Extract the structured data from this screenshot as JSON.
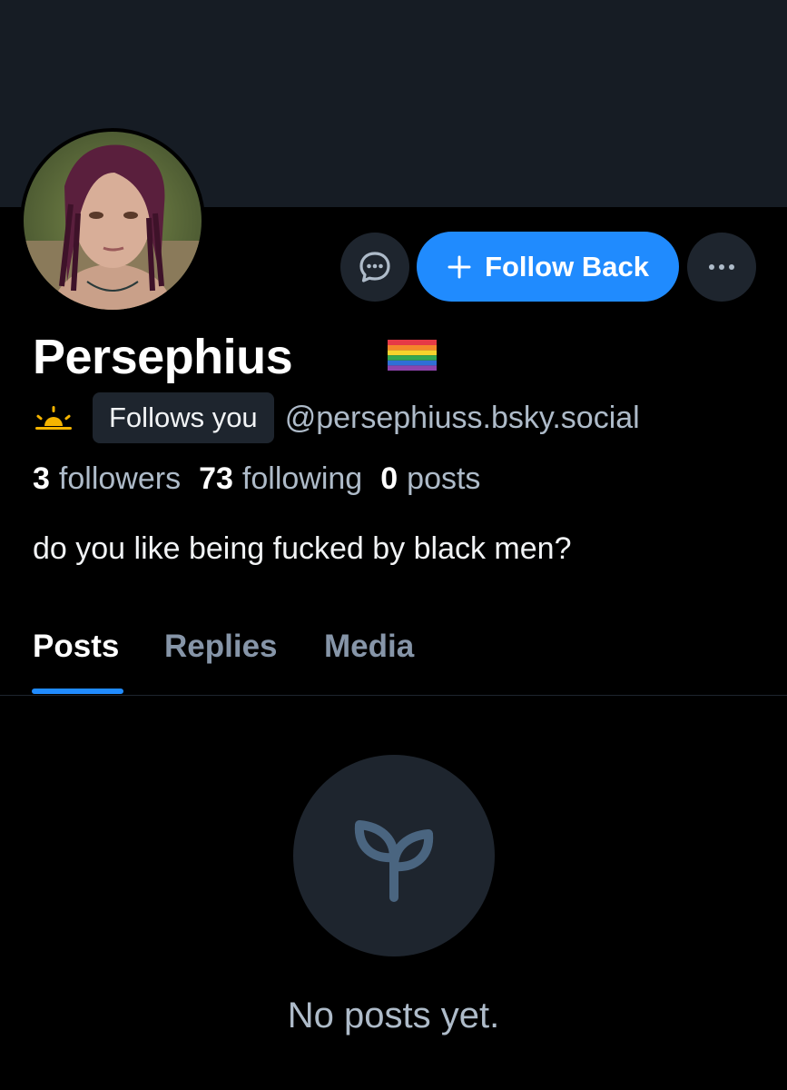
{
  "profile": {
    "display_name": "Persephius",
    "handle": "@persephiuss.bsky.social",
    "follows_you_badge": "Follows you",
    "bio": "do you like being fucked by black men?",
    "name_emoji": "rainbow-flag-icon",
    "label_icon": "sunrise-icon"
  },
  "actions": {
    "message_icon": "chat-bubble-icon",
    "follow_back_label": "Follow Back",
    "follow_icon": "plus-icon",
    "more_icon": "ellipsis-icon"
  },
  "stats": {
    "followers_count": "3",
    "followers_label": "followers",
    "following_count": "73",
    "following_label": "following",
    "posts_count": "0",
    "posts_label": "posts"
  },
  "tabs": [
    {
      "label": "Posts",
      "active": true
    },
    {
      "label": "Replies",
      "active": false
    },
    {
      "label": "Media",
      "active": false
    }
  ],
  "empty_state": {
    "icon": "seedling-icon",
    "text": "No posts yet."
  },
  "colors": {
    "background": "#000000",
    "banner": "#161c24",
    "accent": "#208bfe",
    "muted_text": "#aebbc9",
    "button_surface": "#1e252e"
  }
}
